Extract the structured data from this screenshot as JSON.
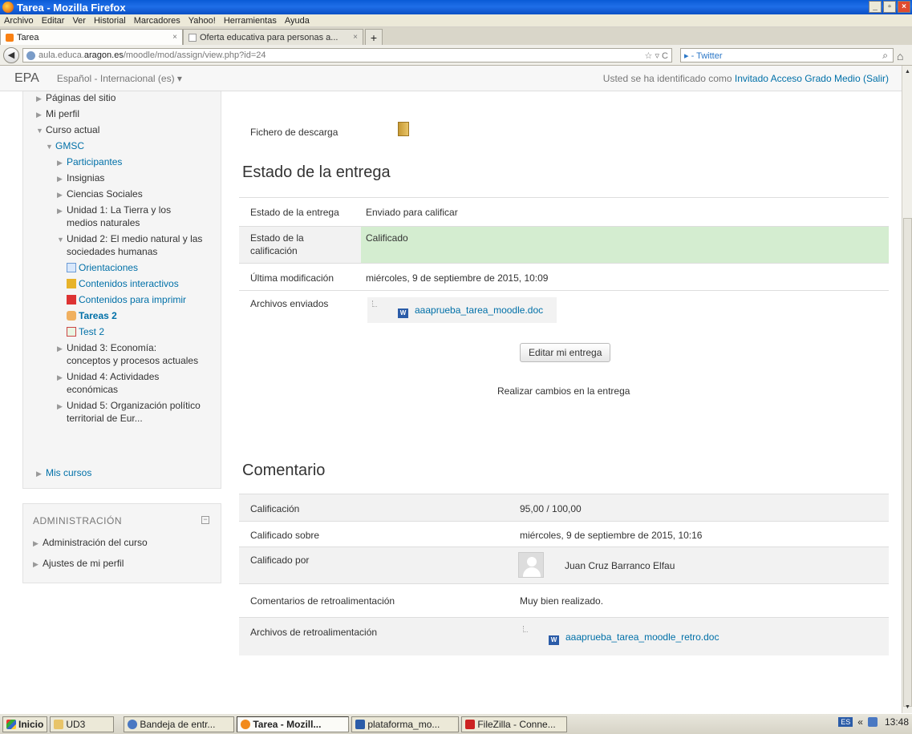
{
  "window": {
    "title": "Tarea - Mozilla Firefox",
    "controls": [
      "_",
      "▫",
      "×"
    ]
  },
  "menu": [
    "Archivo",
    "Editar",
    "Ver",
    "Historial",
    "Marcadores",
    "Yahoo!",
    "Herramientas",
    "Ayuda"
  ],
  "tabs": [
    {
      "label": "Tarea",
      "close": "×"
    },
    {
      "label": "Oferta educativa para personas a...",
      "close": "×"
    }
  ],
  "new_tab": "+",
  "nav": {
    "url_prefix": "aula.educa.",
    "url_domain": "aragon.es",
    "url_path": "/moodle/mod/assign/view.php?id=24",
    "url_tools": "☆ ▿ C",
    "search_engine": "▸ - Twitter"
  },
  "moodle_header": {
    "brand": "EPA",
    "language": "Español - Internacional (es) ▾",
    "login_prefix": "Usted se ha identificado como ",
    "login_user": "Invitado Acceso Grado Medio",
    "logout": "(Salir)"
  },
  "sidebar": {
    "items": [
      "Páginas del sitio",
      "Mi perfil",
      "Curso actual",
      "GMSC",
      "Participantes",
      "Insignias",
      "Ciencias Sociales",
      "Unidad 1: La Tierra y los",
      "medios naturales",
      "Unidad 2: El medio natural y las",
      "sociedades humanas",
      "Orientaciones",
      "Contenidos interactivos",
      "Contenidos para imprimir",
      "Tareas 2",
      "Test 2",
      "Unidad 3: Economía:",
      "conceptos y procesos actuales",
      "Unidad 4: Actividades",
      "económicas",
      "Unidad 5: Organización político",
      "territorial de Eur...",
      "Mis cursos"
    ]
  },
  "admin": {
    "title": "ADMINISTRACIÓN",
    "collapse": "−",
    "items": [
      "Administración del curso",
      "Ajustes de mi perfil"
    ]
  },
  "main": {
    "download_label": "Fichero de descarga",
    "submission_heading": "Estado de la entrega",
    "submission_rows": [
      {
        "label": "Estado de la entrega",
        "value": "Enviado para calificar"
      },
      {
        "label_line1": "Estado de la",
        "label_line2": "calificación",
        "value": "Calificado"
      },
      {
        "label": "Última modificación",
        "value": "miércoles, 9 de septiembre de 2015, 10:09"
      },
      {
        "label": "Archivos enviados",
        "value": "aaaprueba_tarea_moodle.doc"
      }
    ],
    "edit_button": "Editar mi entrega",
    "edit_hint": "Realizar cambios en la entrega",
    "comment_heading": "Comentario",
    "comment_rows": [
      {
        "label": "Calificación",
        "value": "95,00 / 100,00"
      },
      {
        "label": "Calificado sobre",
        "value": "miércoles, 9 de septiembre de 2015, 10:16"
      },
      {
        "label": "Calificado por",
        "value": "Juan Cruz Barranco Elfau"
      },
      {
        "label": "Comentarios de retroalimentación",
        "value": "Muy bien realizado."
      },
      {
        "label": "Archivos de retroalimentación",
        "value": "aaaprueba_tarea_moodle_retro.doc"
      }
    ]
  },
  "taskbar": {
    "start": "Inicio",
    "items": [
      "UD3",
      "Bandeja de entr...",
      "Tarea - Mozill...",
      "plataforma_mo...",
      "FileZilla - Conne..."
    ],
    "lang": "ES",
    "tray_arrows": "«",
    "clock": "13:48"
  },
  "colors": {
    "link": "#0070a8",
    "graded_bg": "#d4edd0",
    "titlebar": "#0a5bd6"
  }
}
